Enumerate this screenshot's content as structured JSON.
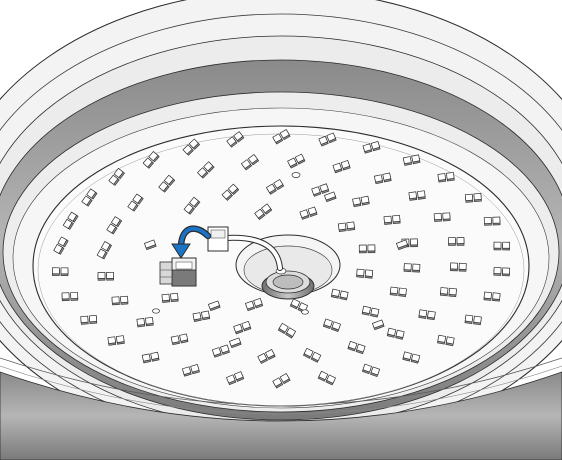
{
  "colors": {
    "background": "#ffffff",
    "rim_light": "#f0f0f0",
    "rim_band": "#a8a8a8",
    "rim_band_dark": "#7d7d7d",
    "plate": "#fbfbfb",
    "outline": "#2c2c2c",
    "led_top": "#ffffff",
    "led_side": "#8c8c8c",
    "arrow": "#1a73c4"
  },
  "icons": {
    "install_arrow": "curved-arrow-icon",
    "connector": "plug-connector-icon"
  }
}
